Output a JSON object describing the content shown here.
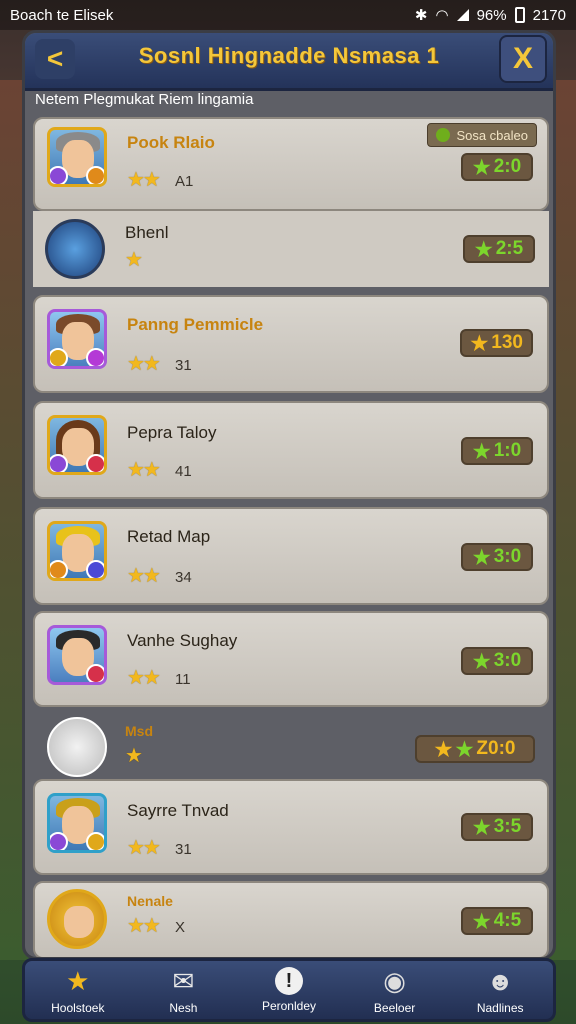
{
  "status": {
    "left_text": "Boach te Elisek",
    "battery": "96%",
    "time": "2170"
  },
  "header": {
    "title": "Sosnl Hingnadde Nsmasa 1",
    "back_label": "<",
    "close_label": "X"
  },
  "subtitle": "Netem Plegmukat Riem lingamia",
  "tag": {
    "text": "Sosa cbaleo"
  },
  "rows": [
    {
      "name": "Pook Rlaio",
      "stars": "★★",
      "level": "A1",
      "score": "2:0",
      "score_icon": "★"
    },
    {
      "name": "Bhenl",
      "stars": "★",
      "level": "",
      "score": "2:5",
      "score_icon": "★"
    },
    {
      "name": "Panng Pemmicle",
      "stars": "★★",
      "level": "31",
      "score": "130",
      "score_icon": "★"
    },
    {
      "name": "Pepra Taloy",
      "stars": "★★",
      "level": "41",
      "score": "1:0",
      "score_icon": "★"
    },
    {
      "name": "Retad Map",
      "stars": "★★",
      "level": "34",
      "score": "3:0",
      "score_icon": "★"
    },
    {
      "name": "Vanhe Sughay",
      "stars": "★★",
      "level": "11",
      "score": "3:0",
      "score_icon": "★"
    },
    {
      "name": "Msd",
      "stars": "★",
      "level": "",
      "score": "Z0:0",
      "score_icon": "★"
    },
    {
      "name": "Sayrre Tnvad",
      "stars": "★★",
      "level": "31",
      "score": "3:5",
      "score_icon": "★"
    },
    {
      "name": "Nenale",
      "stars": "★★",
      "level": "X",
      "score": "4:5",
      "score_icon": "★"
    }
  ],
  "nav": [
    {
      "label": "Hoolstoek",
      "icon": "star-icon"
    },
    {
      "label": "Nesh",
      "icon": "mail-icon"
    },
    {
      "label": "Peronldey",
      "icon": "info-icon"
    },
    {
      "label": "Beeloer",
      "icon": "friends-icon"
    },
    {
      "label": "Nadlines",
      "icon": "profile-icon"
    }
  ],
  "colors": {
    "accent": "#f4c73a",
    "score_green": "#7cd62c",
    "card": "#d9d5ce",
    "header": "#2e3f66"
  }
}
